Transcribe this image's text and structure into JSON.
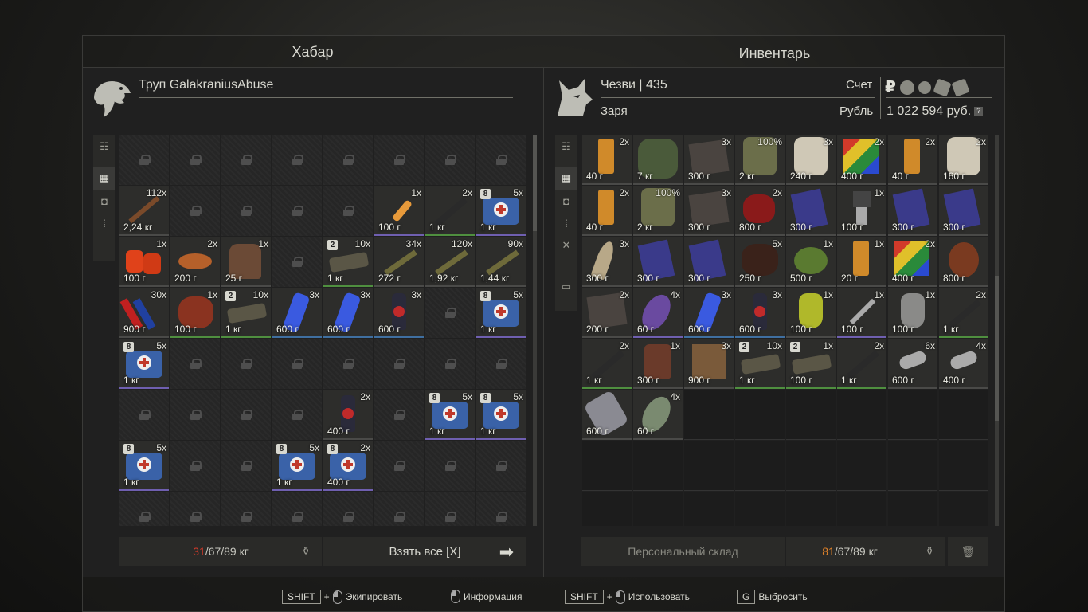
{
  "loot": {
    "title": "Хабар",
    "owner": "Труп GalakraniusAbuse",
    "weight_current": "31",
    "weight_rest": "/67/89 кг",
    "take_all": "Взять все [X]",
    "rows": [
      [
        null,
        null,
        null,
        null,
        null,
        null,
        null,
        null
      ],
      [
        {
          "c": "112x",
          "w": "2,24 кг",
          "q": "plain",
          "art": "ammo-long"
        },
        null,
        null,
        null,
        null,
        {
          "c": "1x",
          "w": "100 г",
          "q": "purple",
          "art": "light-stick"
        },
        {
          "c": "2x",
          "w": "1 кг",
          "q": "green",
          "art": "rail"
        },
        {
          "c": "5x",
          "w": "1 кг",
          "q": "purple",
          "b": "8",
          "art": "medkit"
        }
      ],
      [
        {
          "c": "1x",
          "w": "100 г",
          "q": "plain",
          "art": "gloves"
        },
        {
          "c": "2x",
          "w": "200 г",
          "q": "plain",
          "art": "food"
        },
        {
          "c": "1x",
          "w": "25 г",
          "q": "plain",
          "art": "bread"
        },
        null,
        {
          "c": "10x",
          "w": "1 кг",
          "q": "green",
          "b": "2",
          "art": "mag"
        },
        {
          "c": "34x",
          "w": "272 г",
          "q": "plain",
          "art": "ammo"
        },
        {
          "c": "120x",
          "w": "1,92 кг",
          "q": "plain",
          "art": "ammo"
        },
        {
          "c": "90x",
          "w": "1,44 кг",
          "q": "plain",
          "art": "ammo"
        }
      ],
      [
        {
          "c": "30x",
          "w": "900 г",
          "q": "plain",
          "art": "shells"
        },
        {
          "c": "1x",
          "w": "100 г",
          "q": "green",
          "art": "meat"
        },
        {
          "c": "10x",
          "w": "1 кг",
          "q": "green",
          "b": "2",
          "art": "mag"
        },
        {
          "c": "3x",
          "w": "600 г",
          "q": "blue",
          "art": "blue-can"
        },
        {
          "c": "3x",
          "w": "600 г",
          "q": "blue",
          "art": "blue-can"
        },
        {
          "c": "3x",
          "w": "600 г",
          "q": "blue",
          "art": "bottle"
        },
        null,
        {
          "c": "5x",
          "w": "1 кг",
          "q": "purple",
          "b": "8",
          "art": "medkit"
        }
      ],
      [
        {
          "c": "5x",
          "w": "1 кг",
          "q": "purple",
          "b": "8",
          "art": "medkit"
        },
        null,
        null,
        null,
        null,
        null,
        null,
        null
      ],
      [
        null,
        null,
        null,
        null,
        {
          "c": "2x",
          "w": "400 г",
          "q": "plain",
          "art": "bottle"
        },
        null,
        {
          "c": "5x",
          "w": "1 кг",
          "q": "purple",
          "b": "8",
          "art": "medkit"
        },
        {
          "c": "5x",
          "w": "1 кг",
          "q": "purple",
          "b": "8",
          "art": "medkit"
        }
      ],
      [
        {
          "c": "5x",
          "w": "1 кг",
          "q": "purple",
          "b": "8",
          "art": "medkit"
        },
        null,
        null,
        {
          "c": "5x",
          "w": "1 кг",
          "q": "purple",
          "b": "8",
          "art": "medkit"
        },
        {
          "c": "2x",
          "w": "400 г",
          "q": "purple",
          "b": "8",
          "art": "medkit"
        },
        null,
        null,
        null
      ],
      [
        null,
        null,
        null,
        null,
        null,
        null,
        null,
        null
      ]
    ]
  },
  "inventory": {
    "title": "Инвентарь",
    "player": "Чезви | 435",
    "faction": "Заря",
    "account_label": "Счет",
    "currency_label": "Рубль",
    "currency_symbol": "₽",
    "balance": "1 022 594 руб.",
    "help": "?",
    "stash_button": "Персональный склад",
    "weight_current": "81",
    "weight_rest": "/67/89 кг",
    "rows": [
      [
        {
          "c": "2x",
          "w": "40 г",
          "q": "plain",
          "art": "lighter"
        },
        {
          "c": "",
          "w": "7 кг",
          "q": "plain",
          "art": "camo"
        },
        {
          "c": "3x",
          "w": "300 г",
          "q": "plain",
          "art": "cloth"
        },
        {
          "c": "100%",
          "w": "2 кг",
          "q": "plain",
          "art": "armor"
        },
        {
          "c": "3x",
          "w": "240 г",
          "q": "plain",
          "art": "roll"
        },
        {
          "c": "2x",
          "w": "400 г",
          "q": "plain",
          "art": "cube"
        },
        {
          "c": "2x",
          "w": "40 г",
          "q": "plain",
          "art": "lighter"
        },
        {
          "c": "2x",
          "w": "160 г",
          "q": "plain",
          "art": "roll"
        }
      ],
      [
        {
          "c": "2x",
          "w": "40 г",
          "q": "plain",
          "art": "lighter"
        },
        {
          "c": "100%",
          "w": "2 кг",
          "q": "plain",
          "art": "armor"
        },
        {
          "c": "3x",
          "w": "300 г",
          "q": "plain",
          "art": "cloth"
        },
        {
          "c": "2x",
          "w": "800 г",
          "q": "plain",
          "art": "red-plant"
        },
        {
          "c": "",
          "w": "300 г",
          "q": "plain",
          "art": "book"
        },
        {
          "c": "1x",
          "w": "100 г",
          "q": "plain",
          "art": "chip"
        },
        {
          "c": "",
          "w": "300 г",
          "q": "plain",
          "art": "book"
        },
        {
          "c": "",
          "w": "300 г",
          "q": "plain",
          "art": "book"
        }
      ],
      [
        {
          "c": "3x",
          "w": "300 г",
          "q": "plain",
          "art": "horn"
        },
        {
          "c": "",
          "w": "300 г",
          "q": "plain",
          "art": "book"
        },
        {
          "c": "",
          "w": "300 г",
          "q": "plain",
          "art": "book"
        },
        {
          "c": "5x",
          "w": "250 г",
          "q": "plain",
          "art": "fur"
        },
        {
          "c": "1x",
          "w": "500 г",
          "q": "plain",
          "art": "mine"
        },
        {
          "c": "1x",
          "w": "20 г",
          "q": "plain",
          "art": "lighter"
        },
        {
          "c": "2x",
          "w": "400 г",
          "q": "plain",
          "art": "cube"
        },
        {
          "c": "",
          "w": "800 г",
          "q": "plain",
          "art": "onion"
        }
      ],
      [
        {
          "c": "2x",
          "w": "200 г",
          "q": "plain",
          "art": "cloth"
        },
        {
          "c": "4x",
          "w": "60 г",
          "q": "purple",
          "art": "feather"
        },
        {
          "c": "3x",
          "w": "600 г",
          "q": "blue",
          "art": "blue-can"
        },
        {
          "c": "3x",
          "w": "600 г",
          "q": "blue",
          "art": "bottle"
        },
        {
          "c": "1x",
          "w": "100 г",
          "q": "plain",
          "art": "flask"
        },
        {
          "c": "1x",
          "w": "100 г",
          "q": "purple",
          "art": "syringe"
        },
        {
          "c": "1x",
          "w": "100 г",
          "q": "plain",
          "art": "flask-grey"
        },
        {
          "c": "2x",
          "w": "1 кг",
          "q": "green",
          "art": "rail"
        }
      ],
      [
        {
          "c": "2x",
          "w": "1 кг",
          "q": "green",
          "art": "rail"
        },
        {
          "c": "1x",
          "w": "300 г",
          "q": "plain",
          "art": "coil"
        },
        {
          "c": "3x",
          "w": "900 г",
          "q": "plain",
          "art": "transformer"
        },
        {
          "c": "10x",
          "w": "1 кг",
          "q": "green",
          "b": "2",
          "art": "mag"
        },
        {
          "c": "1x",
          "w": "100 г",
          "q": "green",
          "b": "2",
          "art": "mag"
        },
        {
          "c": "2x",
          "w": "1 кг",
          "q": "green",
          "art": "rail"
        },
        {
          "c": "6x",
          "w": "600 г",
          "q": "plain",
          "art": "capacitor"
        },
        {
          "c": "4x",
          "w": "400 г",
          "q": "plain",
          "art": "capacitor"
        }
      ],
      [
        {
          "c": "",
          "w": "600 г",
          "q": "plain",
          "art": "pliers"
        },
        {
          "c": "4x",
          "w": "60 г",
          "q": "plain",
          "art": "feather-grey"
        },
        "e",
        "e",
        "e",
        "e",
        "e",
        "e"
      ],
      [
        "e",
        "e",
        "e",
        "e",
        "e",
        "e",
        "e",
        "e"
      ],
      [
        "e",
        "e",
        "e",
        "e",
        "e",
        "e",
        "e",
        "e"
      ]
    ]
  },
  "hints": [
    {
      "key": "SHIFT",
      "plus": "+",
      "label": "Экипировать"
    },
    {
      "label": "Информация"
    },
    {
      "key": "SHIFT",
      "plus": "+",
      "label": "Использовать"
    },
    {
      "key": "G",
      "label": "Выбросить"
    }
  ],
  "colors": {
    "accent_red": "#d23a2a",
    "accent_orange": "#e0822a",
    "quality_green": "#4f8f3f",
    "quality_purple": "#6f5fb0",
    "quality_blue": "#3f6fa0"
  }
}
